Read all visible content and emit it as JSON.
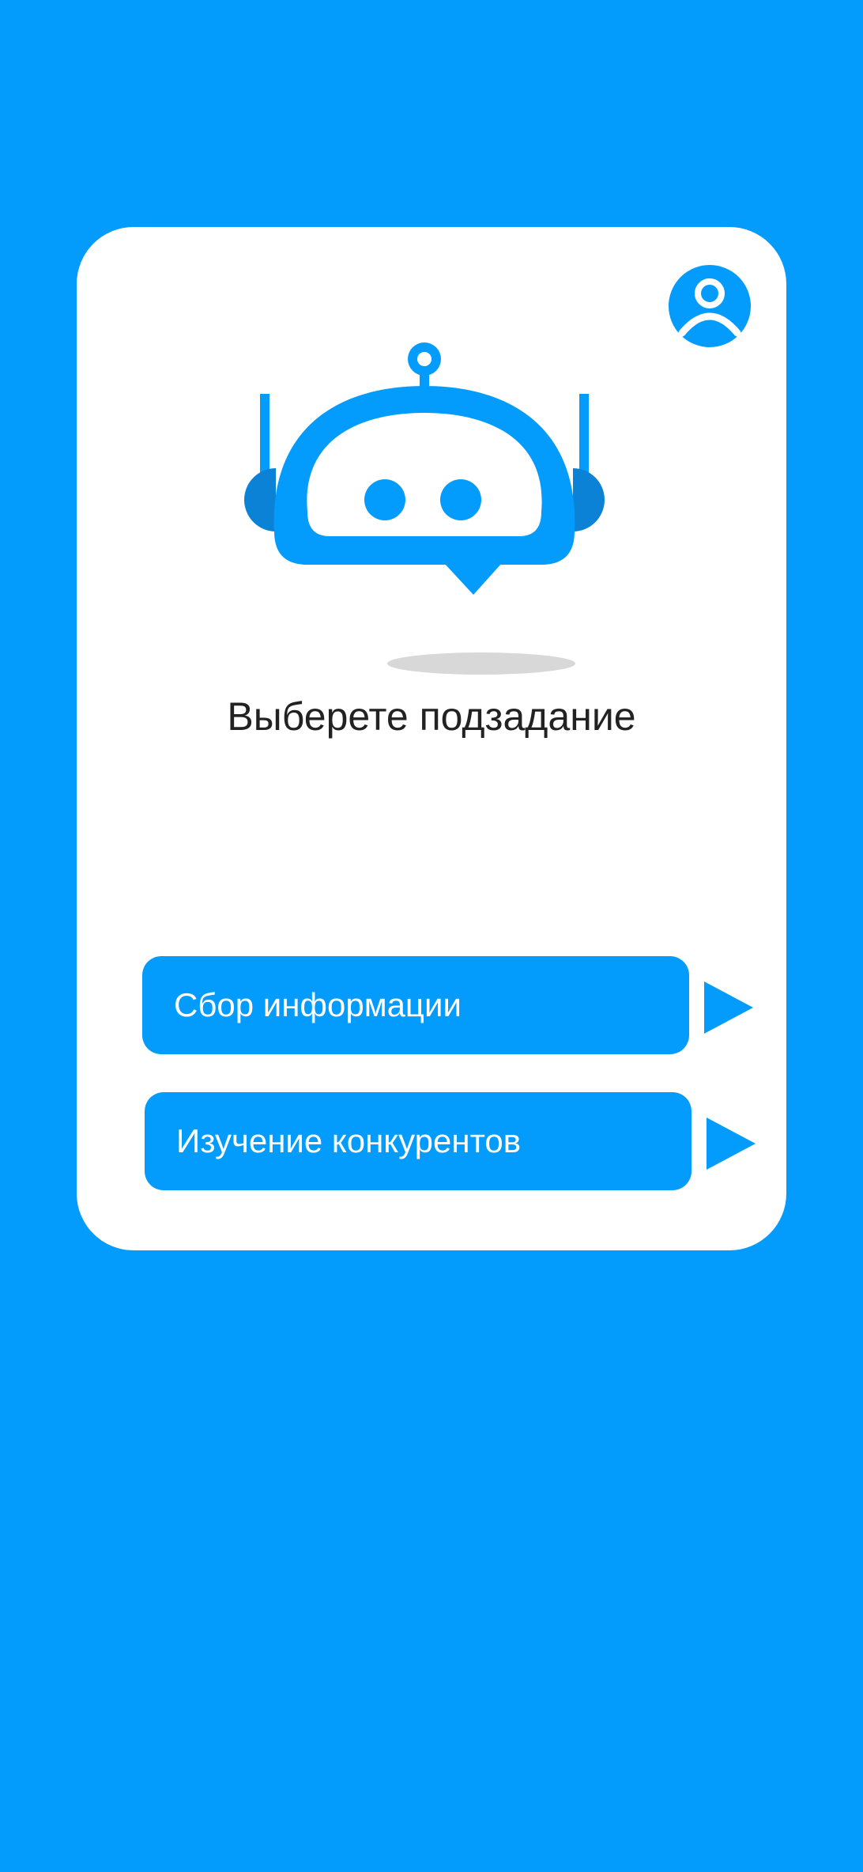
{
  "title": "Выберете подзадание",
  "options": [
    {
      "label": "Сбор информации",
      "arrow_icon": "play-arrow-icon"
    },
    {
      "label": "Изучение конкурентов",
      "arrow_icon": "play-arrow-icon"
    }
  ],
  "icons": {
    "profile": "user-profile-icon",
    "mascot": "chatbot-robot-icon"
  },
  "colors": {
    "background": "#049CFC",
    "card": "#FFFFFF",
    "accent": "#049CFC",
    "accent_dark": "#0B82D6",
    "title_text": "#222222",
    "shadow": "#D8D8D8"
  }
}
